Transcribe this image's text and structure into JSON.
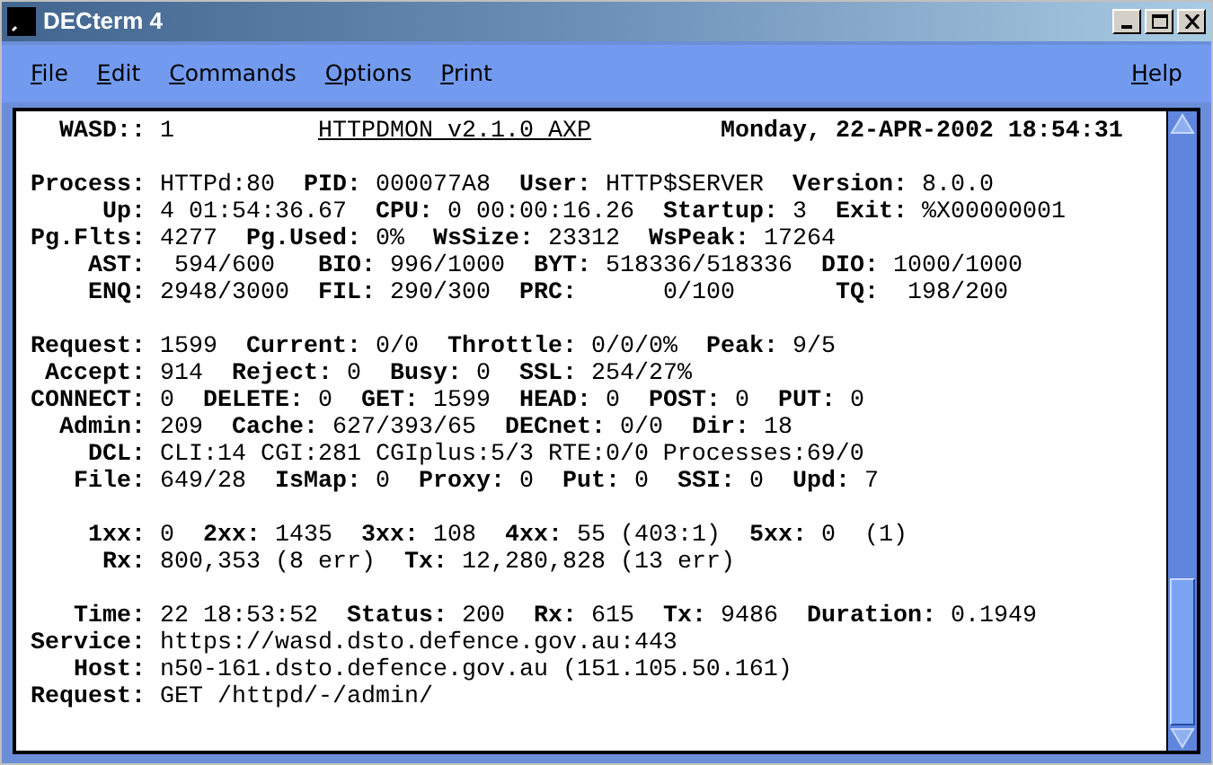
{
  "window": {
    "title": "DECterm 4"
  },
  "menu": [
    {
      "label": "File"
    },
    {
      "label": "Edit"
    },
    {
      "label": "Commands"
    },
    {
      "label": "Options"
    },
    {
      "label": "Print"
    },
    {
      "label": "Help"
    }
  ],
  "header": {
    "label": "WASD::",
    "value": "1",
    "title": "HTTPDMON v2.1.0 AXP",
    "date": "Monday, 22-APR-2002 18:54:31"
  },
  "sections": [
    [
      [
        {
          "label": "Process:",
          "value": "HTTPd:80"
        },
        {
          "label": "PID:",
          "value": "000077A8"
        },
        {
          "label": "User:",
          "value": "HTTP$SERVER"
        },
        {
          "label": "Version:",
          "value": "8.0.0"
        }
      ],
      [
        {
          "label": "Up:",
          "value": "4 01:54:36.67"
        },
        {
          "label": "CPU:",
          "value": "0 00:00:16.26"
        },
        {
          "label": "Startup:",
          "value": "3"
        },
        {
          "label": "Exit:",
          "value": "%X00000001"
        }
      ],
      [
        {
          "label": "Pg.Flts:",
          "value": "4277"
        },
        {
          "label": "Pg.Used:",
          "value": "0%"
        },
        {
          "label": "WsSize:",
          "value": "23312"
        },
        {
          "label": "WsPeak:",
          "value": "17264"
        }
      ],
      [
        {
          "label": "AST:",
          "value": " 594/600 "
        },
        {
          "label": "BIO:",
          "value": "996/1000"
        },
        {
          "label": "BYT:",
          "value": "518336/518336"
        },
        {
          "label": "DIO:",
          "value": "1000/1000"
        }
      ],
      [
        {
          "label": "ENQ:",
          "value": "2948/3000"
        },
        {
          "label": "FIL:",
          "value": "290/300"
        },
        {
          "label": "PRC:",
          "value": "     0/100     "
        },
        {
          "label": "TQ:",
          "value": " 198/200"
        }
      ]
    ],
    [
      [
        {
          "label": "Request:",
          "value": "1599"
        },
        {
          "label": "Current:",
          "value": "0/0"
        },
        {
          "label": "Throttle:",
          "value": "0/0/0%"
        },
        {
          "label": "Peak:",
          "value": "9/5"
        }
      ],
      [
        {
          "label": "Accept:",
          "value": "914"
        },
        {
          "label": "Reject:",
          "value": "0"
        },
        {
          "label": "Busy:",
          "value": "0"
        },
        {
          "label": "SSL:",
          "value": "254/27%"
        }
      ],
      [
        {
          "label": "CONNECT:",
          "value": "0"
        },
        {
          "label": "DELETE:",
          "value": "0"
        },
        {
          "label": "GET:",
          "value": "1599"
        },
        {
          "label": "HEAD:",
          "value": "0"
        },
        {
          "label": "POST:",
          "value": "0"
        },
        {
          "label": "PUT:",
          "value": "0"
        }
      ],
      [
        {
          "label": "Admin:",
          "value": "209"
        },
        {
          "label": "Cache:",
          "value": "627/393/65"
        },
        {
          "label": "DECnet:",
          "value": "0/0"
        },
        {
          "label": "Dir:",
          "value": "18"
        }
      ],
      [
        {
          "label": "DCL:",
          "value": "CLI:14 CGI:281 CGIplus:5/3 RTE:0/0 Processes:69/0"
        }
      ],
      [
        {
          "label": "File:",
          "value": "649/28"
        },
        {
          "label": "IsMap:",
          "value": "0"
        },
        {
          "label": "Proxy:",
          "value": "0"
        },
        {
          "label": "Put:",
          "value": "0"
        },
        {
          "label": "SSI:",
          "value": "0"
        },
        {
          "label": "Upd:",
          "value": "7"
        }
      ]
    ],
    [
      [
        {
          "label": "1xx:",
          "value": "0"
        },
        {
          "label": "2xx:",
          "value": "1435"
        },
        {
          "label": "3xx:",
          "value": "108"
        },
        {
          "label": "4xx:",
          "value": "55 (403:1)"
        },
        {
          "label": "5xx:",
          "value": "0  (1)"
        }
      ],
      [
        {
          "label": "Rx:",
          "value": "800,353 (8 err)"
        },
        {
          "label": "Tx:",
          "value": "12,280,828 (13 err)"
        }
      ]
    ],
    [
      [
        {
          "label": "Time:",
          "value": "22 18:53:52"
        },
        {
          "label": "Status:",
          "value": "200"
        },
        {
          "label": "Rx:",
          "value": "615"
        },
        {
          "label": "Tx:",
          "value": "9486"
        },
        {
          "label": "Duration:",
          "value": "0.1949"
        }
      ],
      [
        {
          "label": "Service:",
          "value": "https://wasd.dsto.defence.gov.au:443"
        }
      ],
      [
        {
          "label": "Host:",
          "value": "n50-161.dsto.defence.gov.au (151.105.50.161)"
        }
      ],
      [
        {
          "label": "Request:",
          "value": "GET /httpd/-/admin/"
        }
      ]
    ]
  ]
}
